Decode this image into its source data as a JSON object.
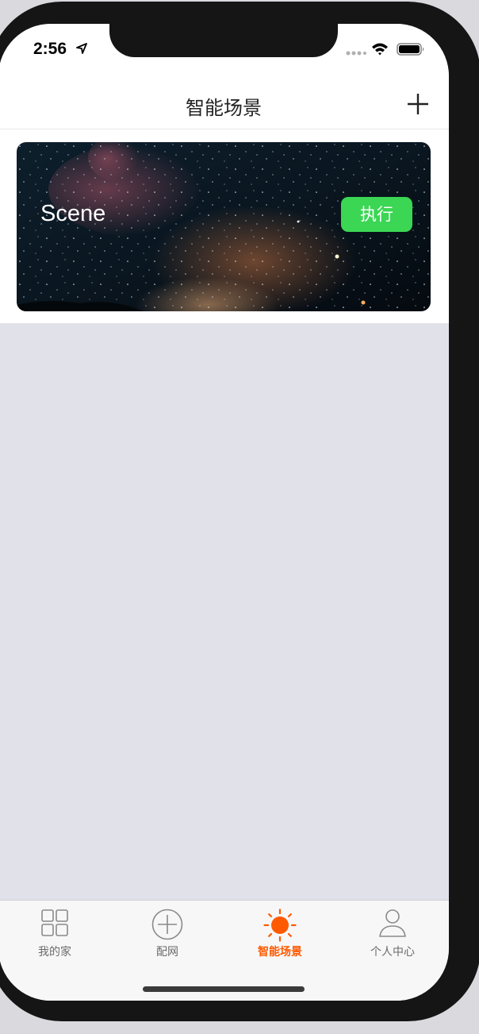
{
  "status_bar": {
    "time": "2:56",
    "icons": [
      "location-arrow-icon",
      "signal-dots-icon",
      "wifi-icon",
      "battery-icon"
    ]
  },
  "header": {
    "title": "智能场景",
    "add_icon": "plus-icon"
  },
  "scenes": [
    {
      "name": "Scene",
      "action_label": "执行",
      "background": "milky-way-night-sky"
    }
  ],
  "tabbar": {
    "tabs": [
      {
        "label": "我的家",
        "icon": "grid-icon",
        "active": false
      },
      {
        "label": "配网",
        "icon": "circle-plus-icon",
        "active": false
      },
      {
        "label": "智能场景",
        "icon": "sun-icon",
        "active": true
      },
      {
        "label": "个人中心",
        "icon": "person-icon",
        "active": false
      }
    ]
  },
  "colors": {
    "accent": "#ff5a00",
    "run_button": "#3bd653",
    "content_background": "#e1e1ea"
  }
}
